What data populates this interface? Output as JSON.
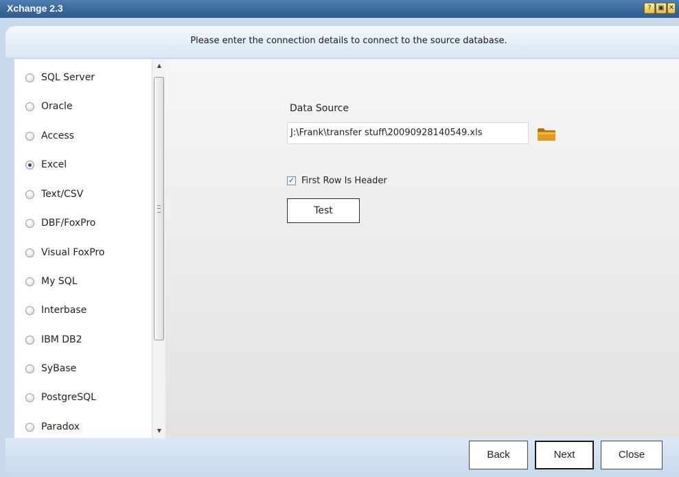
{
  "window": {
    "title": "Xchange 2.3",
    "title_buttons": [
      "help",
      "restore",
      "close"
    ]
  },
  "header": {
    "instruction": "Please enter the connection details to connect to the source database."
  },
  "sources": {
    "items": [
      {
        "label": "SQL Server",
        "selected": false
      },
      {
        "label": "Oracle",
        "selected": false
      },
      {
        "label": "Access",
        "selected": false
      },
      {
        "label": "Excel",
        "selected": true
      },
      {
        "label": "Text/CSV",
        "selected": false
      },
      {
        "label": "DBF/FoxPro",
        "selected": false
      },
      {
        "label": "Visual FoxPro",
        "selected": false
      },
      {
        "label": "My SQL",
        "selected": false
      },
      {
        "label": "Interbase",
        "selected": false
      },
      {
        "label": "IBM DB2",
        "selected": false
      },
      {
        "label": "SyBase",
        "selected": false
      },
      {
        "label": "PostgreSQL",
        "selected": false
      },
      {
        "label": "Paradox",
        "selected": false
      }
    ]
  },
  "form": {
    "data_source_label": "Data Source",
    "data_source_value": "J:\\Frank\\transfer stuff\\20090928140549.xls",
    "first_row_header_label": "First Row Is Header",
    "first_row_header_checked": true,
    "test_button": "Test"
  },
  "footer": {
    "back_label": "Back",
    "next_label": "Next",
    "close_label": "Close"
  },
  "colors": {
    "titlebar": "#3b6a9c",
    "folder": "#d9900f"
  }
}
